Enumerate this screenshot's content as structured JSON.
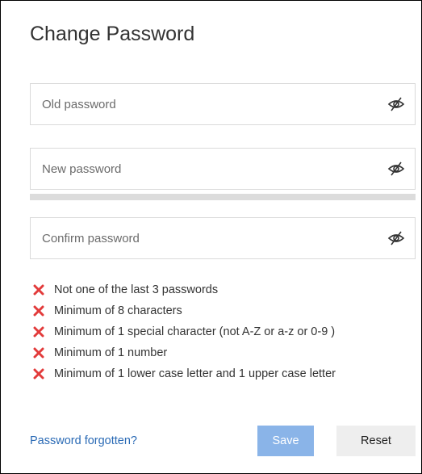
{
  "dialog": {
    "title": "Change Password"
  },
  "fields": {
    "old_password": {
      "placeholder": "Old password",
      "value": "",
      "toggle_icon": "eye-slash-icon"
    },
    "new_password": {
      "placeholder": "New password",
      "value": "",
      "toggle_icon": "eye-slash-icon"
    },
    "confirm_password": {
      "placeholder": "Confirm password",
      "value": "",
      "toggle_icon": "eye-slash-icon"
    }
  },
  "strength_meter": {
    "level": 0
  },
  "rules": [
    {
      "text": "Not one of the last 3 passwords",
      "status": "failed",
      "icon": "x-icon"
    },
    {
      "text": "Minimum of 8 characters",
      "status": "failed",
      "icon": "x-icon"
    },
    {
      "text": "Minimum of 1 special character (not A-Z or a-z or 0-9 )",
      "status": "failed",
      "icon": "x-icon"
    },
    {
      "text": "Minimum of 1 number",
      "status": "failed",
      "icon": "x-icon"
    },
    {
      "text": "Minimum of 1 lower case letter and 1 upper case letter",
      "status": "failed",
      "icon": "x-icon"
    }
  ],
  "footer": {
    "forgot_link": "Password forgotten?",
    "save_label": "Save",
    "reset_label": "Reset"
  },
  "colors": {
    "fail_icon": "#e23b3b",
    "link": "#2a6ab5",
    "save_button": "#8ab4e8",
    "reset_button": "#eeeeee"
  }
}
